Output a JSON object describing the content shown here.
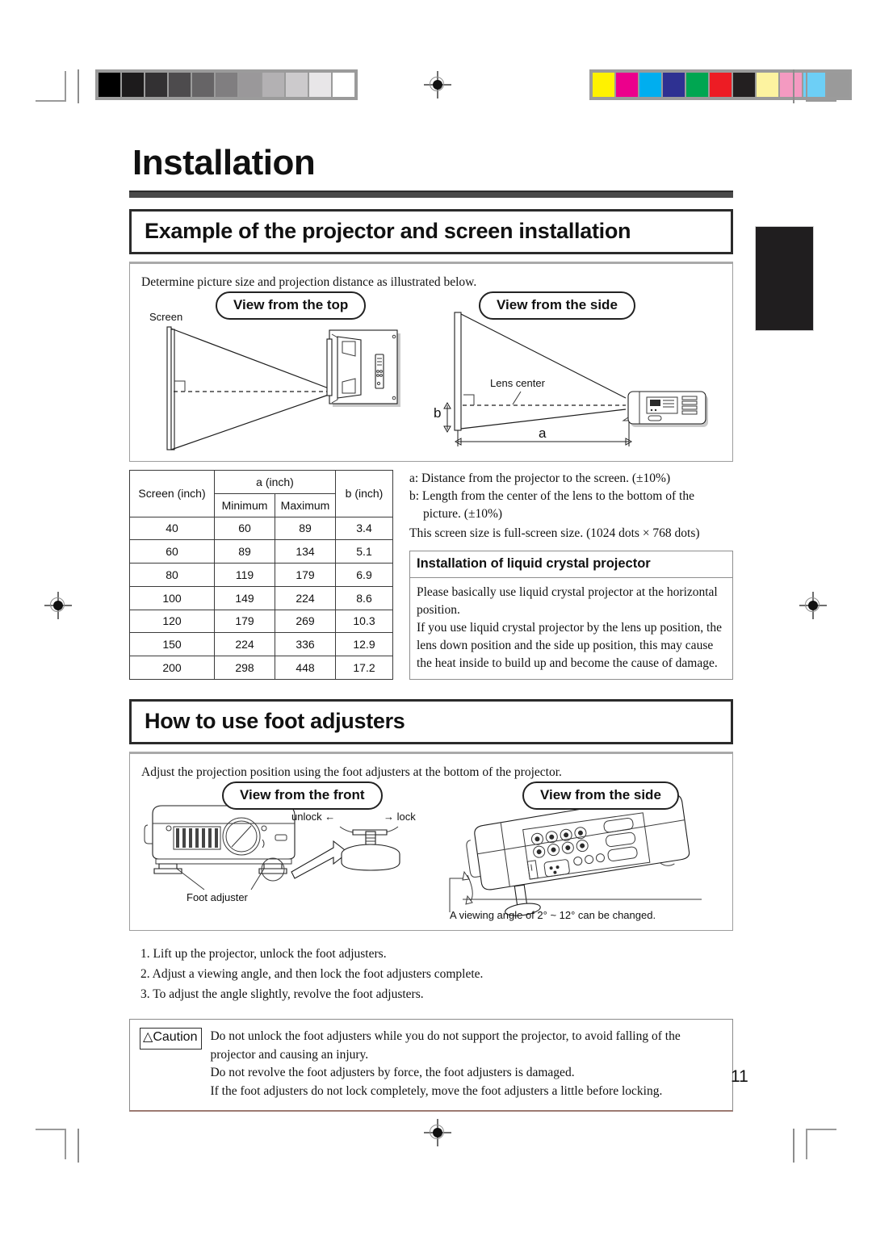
{
  "page": {
    "number": "11",
    "title": "Installation"
  },
  "registration": {
    "grey_scale_label": "grayscale-calibration-bar",
    "grey_swatches": [
      "#000000",
      "#1d1b1c",
      "#333133",
      "#4d4b4d",
      "#666466",
      "#807e80",
      "#9a989a",
      "#b3b1b3",
      "#cccacc",
      "#e8e6e8",
      "#ffffff"
    ],
    "color_swatches": [
      "#fff200",
      "#ec008c",
      "#00aeef",
      "#2e3192",
      "#00a651",
      "#ed1c24",
      "#231f20",
      "#fdf3a0",
      "#f49ac1",
      "#6dcff6",
      "#9a9a9a"
    ],
    "color_bar_label": "color-calibration-bar"
  },
  "section1": {
    "heading": "Example of the projector and screen installation",
    "intro": "Determine picture size and projection distance as illustrated below.",
    "fig_top": {
      "caption": "View from the top",
      "screen_label": "Screen"
    },
    "fig_side": {
      "caption": "View from the side",
      "lens_center_label": "Lens center",
      "dim_b": "b",
      "dim_a": "a"
    },
    "table": {
      "headers": {
        "screen": "Screen (inch)",
        "a": "a (inch)",
        "minimum": "Minimum",
        "maximum": "Maximum",
        "b": "b (inch)"
      },
      "rows": [
        {
          "screen": "40",
          "min": "60",
          "max": "89",
          "b": "3.4"
        },
        {
          "screen": "60",
          "min": "89",
          "max": "134",
          "b": "5.1"
        },
        {
          "screen": "80",
          "min": "119",
          "max": "179",
          "b": "6.9"
        },
        {
          "screen": "100",
          "min": "149",
          "max": "224",
          "b": "8.6"
        },
        {
          "screen": "120",
          "min": "179",
          "max": "269",
          "b": "10.3"
        },
        {
          "screen": "150",
          "min": "224",
          "max": "336",
          "b": "12.9"
        },
        {
          "screen": "200",
          "min": "298",
          "max": "448",
          "b": "17.2"
        }
      ]
    },
    "notes": {
      "a": "a: Distance from the projector to the screen. (±10%)",
      "b_line1": "b: Length from the center of the lens to the bottom of the",
      "b_line2": "picture. (±10%)",
      "full_screen": "This screen size is full-screen size. (1024 dots × 768 dots)"
    },
    "subbox": {
      "heading": "Installation of liquid crystal projector",
      "para1": "Please basically use liquid crystal projector at the horizontal position.",
      "para2": "If you use liquid crystal projector by the lens up position, the lens down position and the side up position, this may cause the heat inside to build up and become the cause of damage."
    }
  },
  "section2": {
    "heading": "How to use foot adjusters",
    "intro": "Adjust the projection position using the foot adjusters at the bottom of the projector.",
    "fig_front": {
      "caption": "View from the front",
      "foot_adjuster_label": "Foot adjuster",
      "unlock_label": "unlock ←",
      "lock_label": "→ lock"
    },
    "fig_side": {
      "caption": "View from the side",
      "angle_note": "A viewing angle of 2° ~ 12° can be changed."
    },
    "steps": [
      "1. Lift up the projector, unlock the foot adjusters.",
      "2. Adjust a viewing angle, and then lock the foot adjusters complete.",
      "3. To adjust the angle slightly, revolve the foot adjusters."
    ],
    "caution": {
      "tag": "Caution",
      "lines": [
        "Do not unlock the foot adjusters while you do not support the projector, to avoid falling of the projector and causing an injury.",
        "Do not revolve the foot adjusters by force, the foot adjusters is damaged.",
        "If the foot adjusters do not lock completely, move the foot adjusters a little before locking."
      ]
    }
  }
}
